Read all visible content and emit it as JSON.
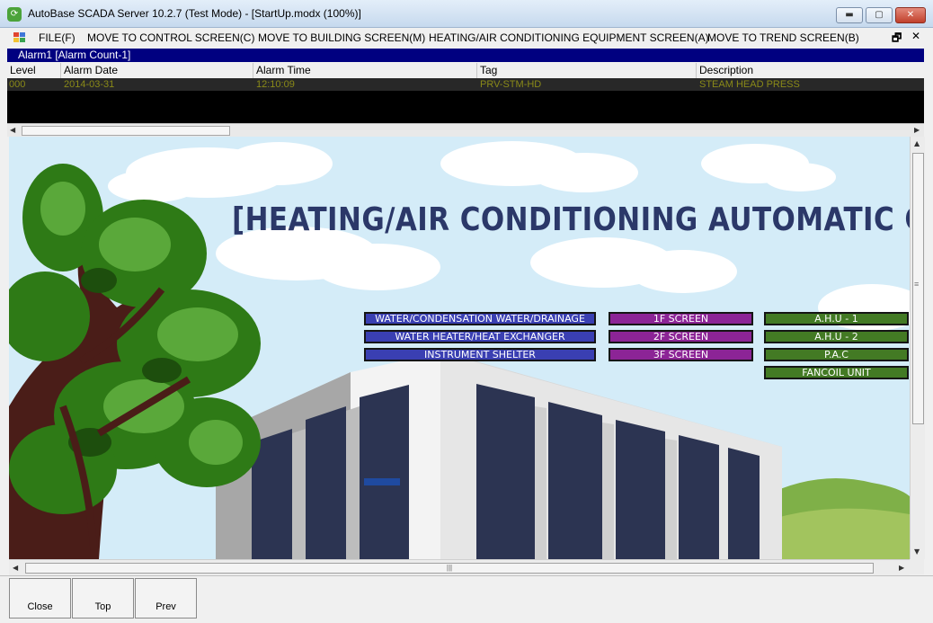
{
  "window": {
    "title": "AutoBase SCADA Server 10.2.7 (Test Mode) - [StartUp.modx (100%)]",
    "app_icon": "autobase-icon",
    "controls": {
      "minimize": "▬",
      "maximize": "▢",
      "close": "✕"
    }
  },
  "menu": {
    "items": [
      {
        "label": "FILE(F)"
      },
      {
        "label": "MOVE TO CONTROL SCREEN(C)"
      },
      {
        "label": "MOVE TO BUILDING SCREEN(M)"
      },
      {
        "label": "HEATING/AIR CONDITIONING EQUIPMENT SCREEN(A)"
      },
      {
        "label": "MOVE TO TREND SCREEN(B)"
      }
    ],
    "mdi_restore": "🗗",
    "mdi_close": "✕"
  },
  "alarm": {
    "title": "Alarm1 [Alarm Count-1]",
    "columns": [
      "Level",
      "Alarm Date",
      "Alarm Time",
      "Tag",
      "Description"
    ],
    "rows": [
      {
        "level": "000",
        "date": "2014-03-31",
        "time": "12:10:09",
        "tag": "PRV-STM-HD",
        "description": "STEAM HEAD PRESS"
      }
    ],
    "row_color": "#8a8a18"
  },
  "scene": {
    "heading": "[HEATING/AIR CONDITIONING AUTOMATIC CONTROL",
    "buttons": {
      "water": "WATER/CONDENSATION WATER/DRAINAGE",
      "heater": "WATER HEATER/HEAT EXCHANGER",
      "shelter": "INSTRUMENT SHELTER",
      "f1": "1F SCREEN",
      "f2": "2F SCREEN",
      "f3": "3F SCREEN",
      "ahu1": "A.H.U - 1",
      "ahu2": "A.H.U - 2",
      "pac": "P.A.C",
      "fancoil": "FANCOIL UNIT"
    },
    "colors": {
      "sky": "#d4ecf8",
      "heading": "#2b3869",
      "blue_button": "#3a3fb2",
      "purple_button": "#8c2496",
      "green_button": "#437a24"
    }
  },
  "scroll": {
    "h_grip": "|||",
    "v_grip": "≡"
  },
  "bottom": {
    "close": "Close",
    "top": "Top",
    "prev": "Prev"
  }
}
